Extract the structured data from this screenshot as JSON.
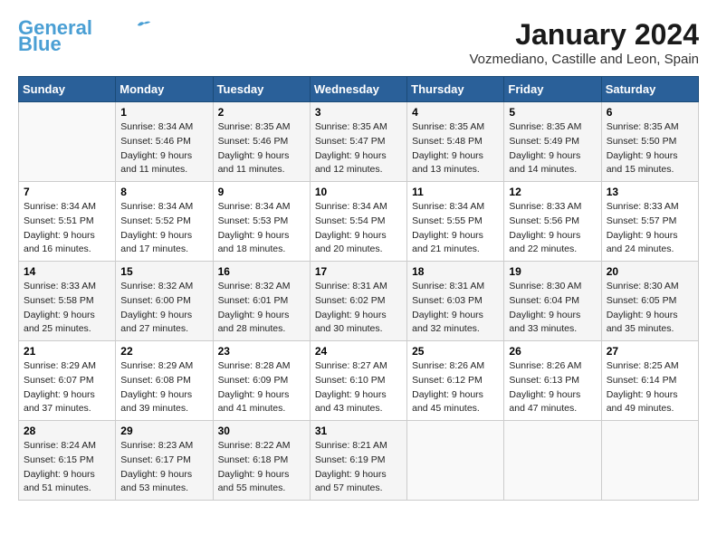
{
  "header": {
    "logo_line1": "General",
    "logo_line2": "Blue",
    "title": "January 2024",
    "subtitle": "Vozmediano, Castille and Leon, Spain"
  },
  "calendar": {
    "headers": [
      "Sunday",
      "Monday",
      "Tuesday",
      "Wednesday",
      "Thursday",
      "Friday",
      "Saturday"
    ],
    "rows": [
      [
        {
          "day": "",
          "info": ""
        },
        {
          "day": "1",
          "info": "Sunrise: 8:34 AM\nSunset: 5:46 PM\nDaylight: 9 hours\nand 11 minutes."
        },
        {
          "day": "2",
          "info": "Sunrise: 8:35 AM\nSunset: 5:46 PM\nDaylight: 9 hours\nand 11 minutes."
        },
        {
          "day": "3",
          "info": "Sunrise: 8:35 AM\nSunset: 5:47 PM\nDaylight: 9 hours\nand 12 minutes."
        },
        {
          "day": "4",
          "info": "Sunrise: 8:35 AM\nSunset: 5:48 PM\nDaylight: 9 hours\nand 13 minutes."
        },
        {
          "day": "5",
          "info": "Sunrise: 8:35 AM\nSunset: 5:49 PM\nDaylight: 9 hours\nand 14 minutes."
        },
        {
          "day": "6",
          "info": "Sunrise: 8:35 AM\nSunset: 5:50 PM\nDaylight: 9 hours\nand 15 minutes."
        }
      ],
      [
        {
          "day": "7",
          "info": "Sunrise: 8:34 AM\nSunset: 5:51 PM\nDaylight: 9 hours\nand 16 minutes."
        },
        {
          "day": "8",
          "info": "Sunrise: 8:34 AM\nSunset: 5:52 PM\nDaylight: 9 hours\nand 17 minutes."
        },
        {
          "day": "9",
          "info": "Sunrise: 8:34 AM\nSunset: 5:53 PM\nDaylight: 9 hours\nand 18 minutes."
        },
        {
          "day": "10",
          "info": "Sunrise: 8:34 AM\nSunset: 5:54 PM\nDaylight: 9 hours\nand 20 minutes."
        },
        {
          "day": "11",
          "info": "Sunrise: 8:34 AM\nSunset: 5:55 PM\nDaylight: 9 hours\nand 21 minutes."
        },
        {
          "day": "12",
          "info": "Sunrise: 8:33 AM\nSunset: 5:56 PM\nDaylight: 9 hours\nand 22 minutes."
        },
        {
          "day": "13",
          "info": "Sunrise: 8:33 AM\nSunset: 5:57 PM\nDaylight: 9 hours\nand 24 minutes."
        }
      ],
      [
        {
          "day": "14",
          "info": "Sunrise: 8:33 AM\nSunset: 5:58 PM\nDaylight: 9 hours\nand 25 minutes."
        },
        {
          "day": "15",
          "info": "Sunrise: 8:32 AM\nSunset: 6:00 PM\nDaylight: 9 hours\nand 27 minutes."
        },
        {
          "day": "16",
          "info": "Sunrise: 8:32 AM\nSunset: 6:01 PM\nDaylight: 9 hours\nand 28 minutes."
        },
        {
          "day": "17",
          "info": "Sunrise: 8:31 AM\nSunset: 6:02 PM\nDaylight: 9 hours\nand 30 minutes."
        },
        {
          "day": "18",
          "info": "Sunrise: 8:31 AM\nSunset: 6:03 PM\nDaylight: 9 hours\nand 32 minutes."
        },
        {
          "day": "19",
          "info": "Sunrise: 8:30 AM\nSunset: 6:04 PM\nDaylight: 9 hours\nand 33 minutes."
        },
        {
          "day": "20",
          "info": "Sunrise: 8:30 AM\nSunset: 6:05 PM\nDaylight: 9 hours\nand 35 minutes."
        }
      ],
      [
        {
          "day": "21",
          "info": "Sunrise: 8:29 AM\nSunset: 6:07 PM\nDaylight: 9 hours\nand 37 minutes."
        },
        {
          "day": "22",
          "info": "Sunrise: 8:29 AM\nSunset: 6:08 PM\nDaylight: 9 hours\nand 39 minutes."
        },
        {
          "day": "23",
          "info": "Sunrise: 8:28 AM\nSunset: 6:09 PM\nDaylight: 9 hours\nand 41 minutes."
        },
        {
          "day": "24",
          "info": "Sunrise: 8:27 AM\nSunset: 6:10 PM\nDaylight: 9 hours\nand 43 minutes."
        },
        {
          "day": "25",
          "info": "Sunrise: 8:26 AM\nSunset: 6:12 PM\nDaylight: 9 hours\nand 45 minutes."
        },
        {
          "day": "26",
          "info": "Sunrise: 8:26 AM\nSunset: 6:13 PM\nDaylight: 9 hours\nand 47 minutes."
        },
        {
          "day": "27",
          "info": "Sunrise: 8:25 AM\nSunset: 6:14 PM\nDaylight: 9 hours\nand 49 minutes."
        }
      ],
      [
        {
          "day": "28",
          "info": "Sunrise: 8:24 AM\nSunset: 6:15 PM\nDaylight: 9 hours\nand 51 minutes."
        },
        {
          "day": "29",
          "info": "Sunrise: 8:23 AM\nSunset: 6:17 PM\nDaylight: 9 hours\nand 53 minutes."
        },
        {
          "day": "30",
          "info": "Sunrise: 8:22 AM\nSunset: 6:18 PM\nDaylight: 9 hours\nand 55 minutes."
        },
        {
          "day": "31",
          "info": "Sunrise: 8:21 AM\nSunset: 6:19 PM\nDaylight: 9 hours\nand 57 minutes."
        },
        {
          "day": "",
          "info": ""
        },
        {
          "day": "",
          "info": ""
        },
        {
          "day": "",
          "info": ""
        }
      ]
    ]
  }
}
